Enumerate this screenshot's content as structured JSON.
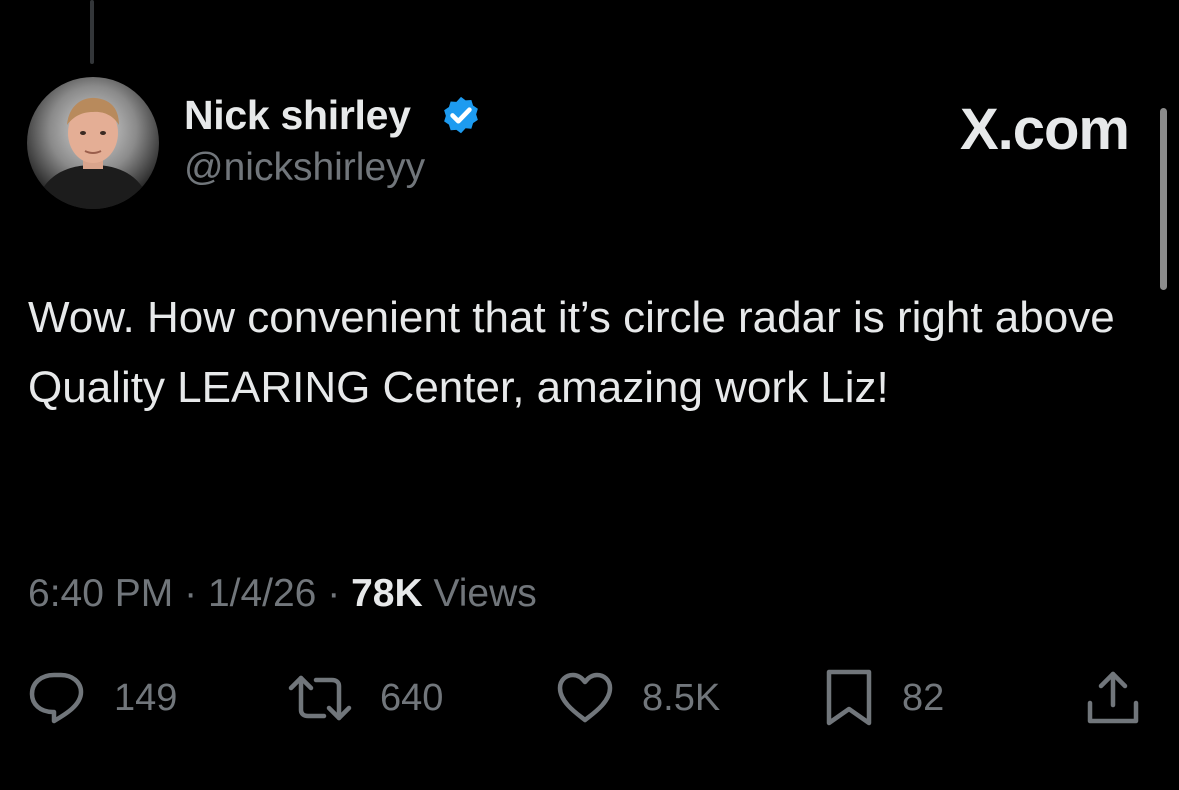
{
  "tweet": {
    "author": {
      "name": "Nick shirley",
      "handle": "@nickshirleyy",
      "verified": true
    },
    "site_logo": "X.com",
    "text": "Wow. How convenient that it’s circle radar is right above Quality LEARING Center, amazing work Liz!",
    "time": "6:40 PM",
    "separator": "·",
    "date": "1/4/26",
    "views_count": "78K",
    "views_label": "Views",
    "actions": {
      "replies": "149",
      "reposts": "640",
      "likes": "8.5K",
      "bookmarks": "82"
    }
  },
  "icons": {
    "reply": "reply-bubble-icon",
    "repost": "repost-arrows-icon",
    "like": "heart-icon",
    "bookmark": "bookmark-icon",
    "share": "share-upload-icon",
    "verified": "verified-badge-icon"
  },
  "colors": {
    "background": "#000000",
    "primary_text": "#e7e9ea",
    "secondary_text": "#71767b",
    "verified_blue": "#1d9bf0"
  }
}
